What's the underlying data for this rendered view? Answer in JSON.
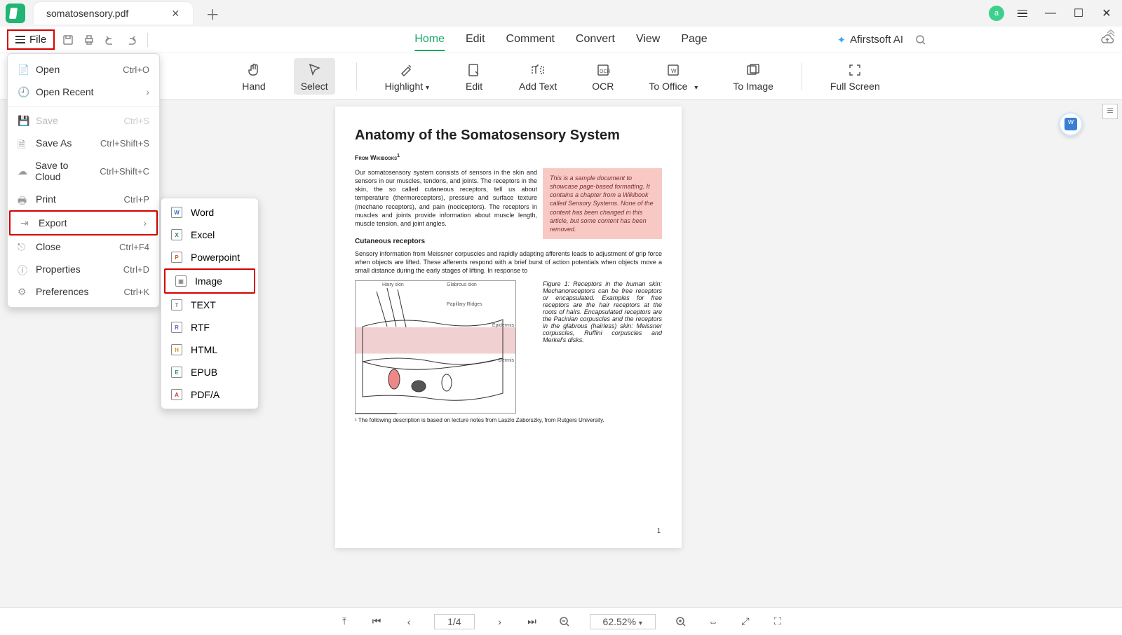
{
  "titlebar": {
    "tab_name": "somatosensory.pdf",
    "avatar_letter": "a"
  },
  "toolbar": {
    "file_label": "File",
    "nav": [
      "Home",
      "Edit",
      "Comment",
      "Convert",
      "View",
      "Page"
    ],
    "active_nav": "Home",
    "ai_label": "Afirstsoft AI"
  },
  "ribbon": {
    "items": [
      "Hand",
      "Select",
      "Highlight",
      "Edit",
      "Add Text",
      "OCR",
      "To Office",
      "To Image",
      "Full Screen"
    ],
    "selected": "Select"
  },
  "file_menu": {
    "open": {
      "label": "Open",
      "shortcut": "Ctrl+O"
    },
    "open_recent": {
      "label": "Open Recent"
    },
    "save": {
      "label": "Save",
      "shortcut": "Ctrl+S"
    },
    "save_as": {
      "label": "Save As",
      "shortcut": "Ctrl+Shift+S"
    },
    "save_cloud": {
      "label": "Save to Cloud",
      "shortcut": "Ctrl+Shift+C"
    },
    "print": {
      "label": "Print",
      "shortcut": "Ctrl+P"
    },
    "export": {
      "label": "Export"
    },
    "close": {
      "label": "Close",
      "shortcut": "Ctrl+F4"
    },
    "properties": {
      "label": "Properties",
      "shortcut": "Ctrl+D"
    },
    "preferences": {
      "label": "Preferences",
      "shortcut": "Ctrl+K"
    }
  },
  "export_menu": {
    "word": "Word",
    "excel": "Excel",
    "powerpoint": "Powerpoint",
    "image": "Image",
    "text": "TEXT",
    "rtf": "RTF",
    "html": "HTML",
    "epub": "EPUB",
    "pdfa": "PDF/A"
  },
  "document": {
    "title": "Anatomy of the Somatosensory System",
    "from": "From Wikibooks",
    "p1": "Our somatosensory system consists of sensors in the skin and sensors in our muscles, tendons, and joints. The receptors in the skin, the so called cutaneous receptors, tell us about temperature (thermoreceptors), pressure and surface texture (mechano receptors), and pain (nociceptors). The receptors in muscles and joints provide information about muscle length, muscle tension, and joint angles.",
    "note": "This is a sample document to showcase page-based formatting. It contains a chapter from a Wikibook called Sensory Systems. None of the content has been changed in this article, but some content has been removed.",
    "sub1": "Cutaneous receptors",
    "p2": "Sensory information from Meissner corpuscles and rapidly adapting afferents leads to adjustment of grip force when objects are lifted. These afferents respond with a brief burst of action potentials when objects move a small distance during the early stages of lifting. In response to",
    "fig_caption": "Figure 1: Receptors in the human skin: Mechanoreceptors can be free receptors or encapsulated. Examples for free receptors are the hair receptors at the roots of hairs. Encapsulated receptors are the Pacinian corpuscles and the receptors in the glabrous (hairless) skin: Meissner corpuscles, Ruffini corpuscles and Merkel's disks.",
    "fn_text": "¹ The following description is based on lecture notes from Laszlo Zaborszky, from Rutgers University.",
    "page_num": "1",
    "fig_labels": {
      "hairy": "Hairy skin",
      "glabrous": "Glabrous skin",
      "epidermis": "Epidermis",
      "dermis": "Dermis",
      "papillary": "Papillary Ridges"
    }
  },
  "statusbar": {
    "page_indicator": "1/4",
    "zoom": "62.52%"
  }
}
